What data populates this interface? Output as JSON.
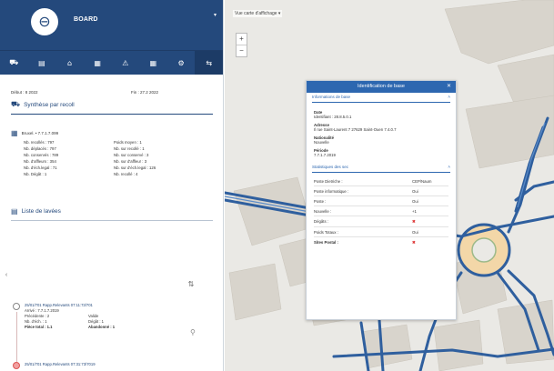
{
  "sidebar": {
    "logo_icon": "globe-icon",
    "app_name": "BOARD",
    "close_icon": "close-icon",
    "tabs": [
      {
        "icon": "car-icon",
        "glyph": "⛟"
      },
      {
        "icon": "document-icon",
        "glyph": "▤"
      },
      {
        "icon": "home-icon",
        "glyph": "⌂"
      },
      {
        "icon": "list-icon",
        "glyph": "▦"
      },
      {
        "icon": "warning-icon",
        "glyph": "⚠"
      },
      {
        "icon": "calendar-icon",
        "glyph": "▦"
      },
      {
        "icon": "settings-icon",
        "glyph": "⚙"
      },
      {
        "icon": "arrows-icon",
        "glyph": "⇆"
      }
    ],
    "date_start": "Début : 8 2022",
    "date_end": "Fin : 27.2 2022",
    "summary_title": "Synthèse par recoll",
    "period": "Bruxel. • 7.7.1.7.099",
    "stats_left": [
      "Nb. recollés : 797",
      "Nb. déplacés : 797",
      "Nb. conservés : 789",
      "Nb. d'affleurs : 354",
      "Nb. d'éch.legal : 71",
      "Nb. Dégât : 1"
    ],
    "stats_right": [
      "Poids moyen : 1",
      "Nb. sur recollé : 1",
      "Nb. sur conservé : 3",
      "Nb. sur d'affleur : 3",
      "Nb. sur d'éch.legal : 126",
      "Nb. recollé : 4"
    ],
    "alerts_title": "Liste de lavées",
    "alert_1_title": "25/01/701 Rapp.Relevants 07:11:73/701",
    "alert_1_sub": "Arrivé : 7.7.1.7.2019",
    "alert_1_l1": "Précédente : 2",
    "alert_1_r1": "Valide",
    "alert_1_l2": "Nb. d'éch. : 1",
    "alert_1_r2": "Dégât : 1",
    "alert_1_l3": "Pièce total : 1.1",
    "alert_1_r3": "Abandonné : 1",
    "alert_2_title": "25/01/701 Rapp.Relevants 07:31:73/7019"
  },
  "map": {
    "layer_label": "Vue carte d'affichage",
    "zoom_in": "+",
    "zoom_out": "−",
    "popup": {
      "title": "Identification de base",
      "section1": "Informations de base",
      "fields": [
        {
          "label": "Date",
          "value": "Identifiant : 28.8.5.0.1"
        },
        {
          "label": "Adresse",
          "value": "Il rue Saint-Laurent 7 27629 Saint-Ouen 7.4.0.7"
        },
        {
          "label": "Nationalité",
          "value": "Nouvelle"
        },
        {
          "label": "Période",
          "value": "7.7.1.7.2019"
        }
      ],
      "section2": "Statistiques des sec",
      "stats": [
        {
          "label": "Poste Dietriche :",
          "value": "CEP/Naum"
        },
        {
          "label": "Poste informatique :",
          "value": "Oui"
        },
        {
          "label": "Poste :",
          "value": "Oui"
        },
        {
          "label": "Nouvelle :",
          "value": "+1"
        },
        {
          "label": "Dégâts :",
          "value": "✖"
        },
        {
          "label": "Poids Totaux :",
          "value": "Oui"
        },
        {
          "label": "Sites Postal :",
          "value": "✖"
        }
      ]
    }
  }
}
